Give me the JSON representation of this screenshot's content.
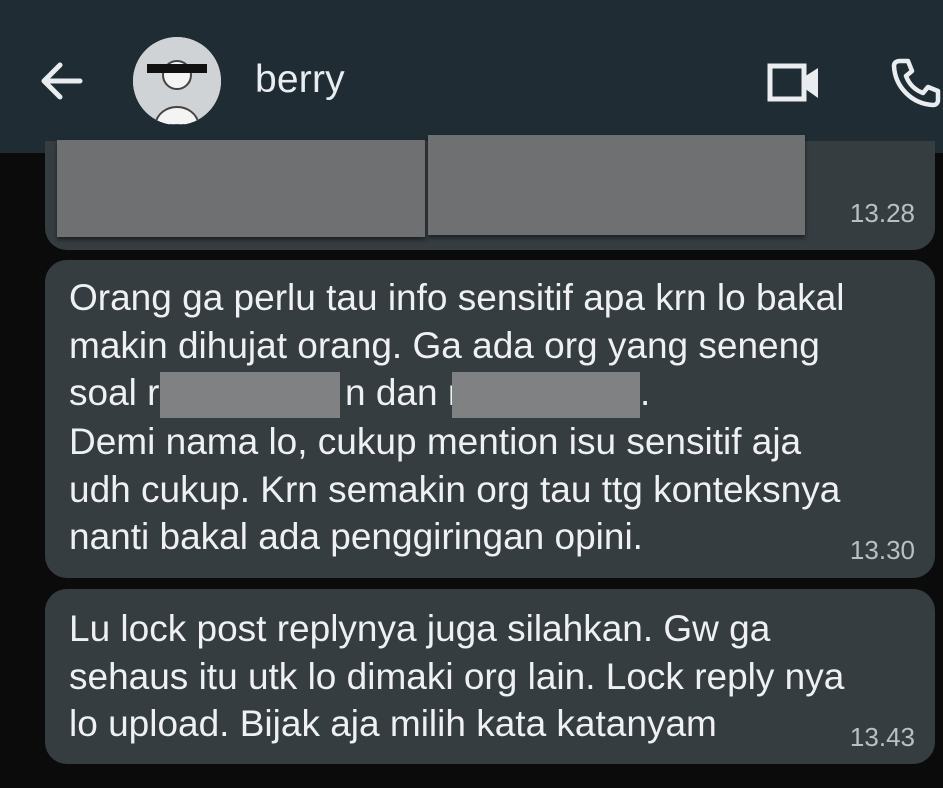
{
  "header": {
    "back_icon": "arrow-left-icon",
    "contact_name": "berry",
    "video_icon": "video-camera-icon",
    "call_icon": "phone-icon",
    "background": "#1f2c34"
  },
  "messages": [
    {
      "time": "13.28",
      "content": "redacted-image"
    },
    {
      "lines": [
        "Orang ga perlu tau info sensitif apa krn lo bakal",
        "makin dihujat orang. Ga ada org yang seneng",
        "soal r",
        "n dan r",
        ".",
        "Demi nama lo, cukup mention isu sensitif aja",
        "udh cukup. Krn semakin org tau ttg konteksnya",
        "nanti bakal ada penggiringan opini."
      ],
      "time": "13.30"
    },
    {
      "lines": [
        "Lu lock post replynya juga silahkan. Gw ga",
        "sehaus itu utk lo dimaki org lain. Lock reply nya",
        "lo upload. Bijak aja milih kata katanyam"
      ],
      "time": "13.43"
    }
  ],
  "colors": {
    "bubble": "#353d41",
    "text": "#eef0f1",
    "timestamp": "#b9c0c4",
    "redaction": "#6e7072"
  }
}
